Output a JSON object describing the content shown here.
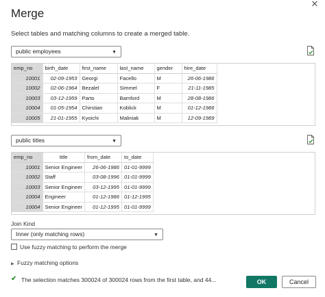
{
  "dialog": {
    "title": "Merge",
    "subtitle": "Select tables and matching columns to create a merged table.",
    "close_glyph": "✕"
  },
  "first_table": {
    "selected": "public employees",
    "columns": [
      "emp_no",
      "birth_date",
      "first_name",
      "last_name",
      "gender",
      "hire_date"
    ],
    "rows": [
      [
        "10001",
        "02-09-1953",
        "Georgi",
        "Facello",
        "M",
        "26-06-1986"
      ],
      [
        "10002",
        "02-06-1964",
        "Bezalel",
        "Simmel",
        "F",
        "21-11-1985"
      ],
      [
        "10003",
        "03-12-1959",
        "Parto",
        "Bamford",
        "M",
        "28-08-1986"
      ],
      [
        "10004",
        "01-05-1954",
        "Chirstian",
        "Koblick",
        "M",
        "01-12-1986"
      ],
      [
        "10005",
        "21-01-1955",
        "Kyoichi",
        "Maliniak",
        "M",
        "12-09-1989"
      ]
    ]
  },
  "second_table": {
    "selected": "public titles",
    "columns": [
      "emp_no",
      "title",
      "from_date",
      "to_date"
    ],
    "rows": [
      [
        "10001",
        "Senior Engineer",
        "26-06-1986",
        "01-01-9999"
      ],
      [
        "10002",
        "Staff",
        "03-08-1996",
        "01-01-9999"
      ],
      [
        "10003",
        "Senior Engineer",
        "03-12-1995",
        "01-01-9999"
      ],
      [
        "10004",
        "Engineer",
        "01-12-1986",
        "01-12-1995"
      ],
      [
        "10004",
        "Senior Engineer",
        "01-12-1995",
        "01-01-9999"
      ]
    ]
  },
  "join_kind": {
    "label": "Join Kind",
    "selected": "Inner (only matching rows)"
  },
  "fuzzy": {
    "checkbox_label": "Use fuzzy matching to perform the merge",
    "options_label": "Fuzzy matching options"
  },
  "status": {
    "text": "The selection matches 300024 of 300024 rows from the first table, and 44..."
  },
  "buttons": {
    "ok": "OK",
    "cancel": "Cancel"
  },
  "colors": {
    "accent": "#117865",
    "key_column": "#d9d9d9",
    "success": "#107c10"
  }
}
